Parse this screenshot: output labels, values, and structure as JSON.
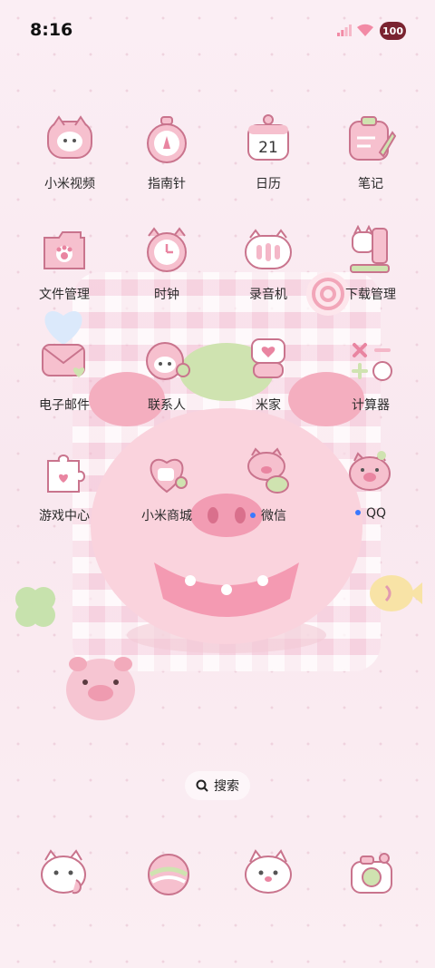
{
  "status_bar": {
    "time": "8:16",
    "battery": "100"
  },
  "apps": [
    {
      "label": "小米视频",
      "icon": "video-cat-icon",
      "notification": false
    },
    {
      "label": "指南针",
      "icon": "compass-icon",
      "notification": false
    },
    {
      "label": "日历",
      "icon": "calendar-icon",
      "date": "21",
      "notification": false
    },
    {
      "label": "笔记",
      "icon": "notes-icon",
      "notification": false
    },
    {
      "label": "文件管理",
      "icon": "folder-icon",
      "notification": false
    },
    {
      "label": "时钟",
      "icon": "clock-icon",
      "notification": false
    },
    {
      "label": "录音机",
      "icon": "recorder-icon",
      "notification": false
    },
    {
      "label": "下载管理",
      "icon": "download-icon",
      "notification": false
    },
    {
      "label": "电子邮件",
      "icon": "mail-icon",
      "notification": false
    },
    {
      "label": "联系人",
      "icon": "contacts-icon",
      "notification": false
    },
    {
      "label": "米家",
      "icon": "mihome-icon",
      "notification": false
    },
    {
      "label": "计算器",
      "icon": "calculator-icon",
      "notification": false
    },
    {
      "label": "游戏中心",
      "icon": "puzzle-icon",
      "notification": false
    },
    {
      "label": "小米商城",
      "icon": "store-heart-icon",
      "notification": false
    },
    {
      "label": "微信",
      "icon": "wechat-pig-icon",
      "notification": true
    },
    {
      "label": "QQ",
      "icon": "qq-pig-icon",
      "notification": true
    }
  ],
  "search": {
    "label": "搜索"
  },
  "dock": [
    {
      "icon": "phone-cat-icon"
    },
    {
      "icon": "browser-planet-icon"
    },
    {
      "icon": "messages-cat-icon"
    },
    {
      "icon": "camera-icon"
    }
  ],
  "colors": {
    "icon_pink": "#f4b7c8",
    "icon_outline": "#c9748d",
    "wallpaper": "#fbeef4",
    "notification_dot": "#3a78ff"
  }
}
